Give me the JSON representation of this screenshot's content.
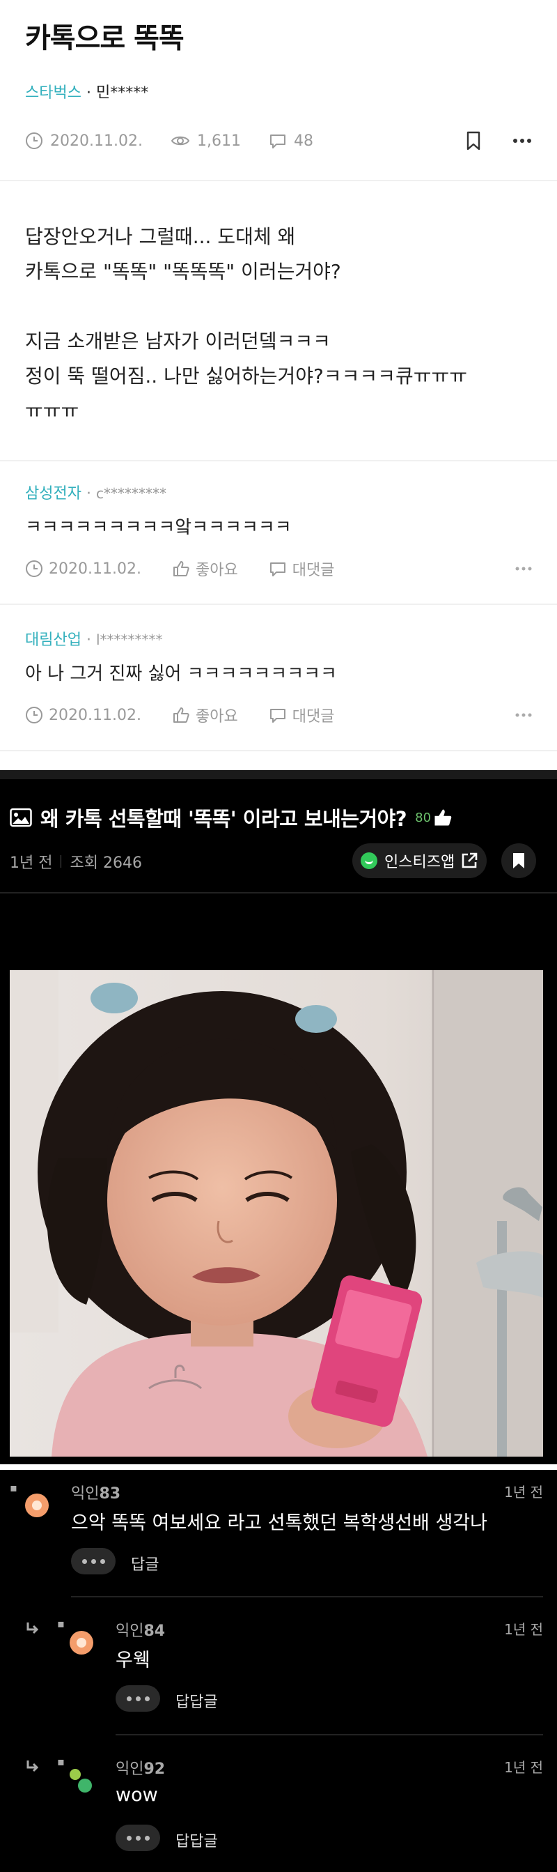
{
  "post": {
    "title": "카톡으로 똑똑",
    "company": "스타벅스",
    "separator": " · ",
    "author": "민*****",
    "date": "2020.11.02.",
    "views": "1,611",
    "comments": "48",
    "body": "답장안오거나 그럴때... 도대체 왜\n카톡으로 \"똑똑\" \"똑똑똑\" 이러는거야?\n\n지금 소개받은 남자가 이러던뎈ㅋㅋㅋ\n정이 뚝 떨어짐.. 나만 싫어하는거야?ㅋㅋㅋㅋ큐ㅠㅠㅠ\nㅠㅠㅠ"
  },
  "comments": [
    {
      "company": "삼성전자",
      "author": "c*********",
      "text": "ㅋㅋㅋㅋㅋㅋㅋㅋㅋ앜ㅋㅋㅋㅋㅋㅋ",
      "date": "2020.11.02.",
      "like_label": "좋아요",
      "reply_label": "대댓글"
    },
    {
      "company": "대림산업",
      "author": "l*********",
      "text": "아 나 그거 진짜 싫어 ㅋㅋㅋㅋㅋㅋㅋㅋㅋ",
      "date": "2020.11.02.",
      "like_label": "좋아요",
      "reply_label": "대댓글"
    }
  ],
  "dark_post": {
    "title": "왜 카톡 선톡할때 '똑똑' 이라고 보내는거야?",
    "likes": "80",
    "age": "1년 전",
    "views": "조회 2646",
    "app_button": "인스티즈앱"
  },
  "dark_comments": [
    {
      "name_prefix": "익인",
      "name_num": "83",
      "time": "1년 전",
      "text": "으악 똑똑 여보세요 라고 선톡했던 복학생선배 생각나",
      "reply_label": "답글"
    },
    {
      "name_prefix": "익인",
      "name_num": "84",
      "time": "1년 전",
      "text": "우웩",
      "reply_label": "답답글"
    },
    {
      "name_prefix": "익인",
      "name_num": "92",
      "time": "1년 전",
      "text": "wow",
      "reply_label": "답답글"
    }
  ],
  "colors": {
    "company_accent": "#33b0bd",
    "meta_gray": "#9a9a9a",
    "dark_bg": "#000000",
    "likes_green": "#6bbf6b",
    "insti_green": "#32c95a",
    "avatar_orange": "#f49d6b"
  },
  "icons": [
    "clock-icon",
    "eye-icon",
    "speech-bubble-icon",
    "bookmark-icon",
    "more-icon",
    "thumbs-up-icon",
    "image-icon",
    "external-link-icon",
    "reply-arrow-icon"
  ]
}
